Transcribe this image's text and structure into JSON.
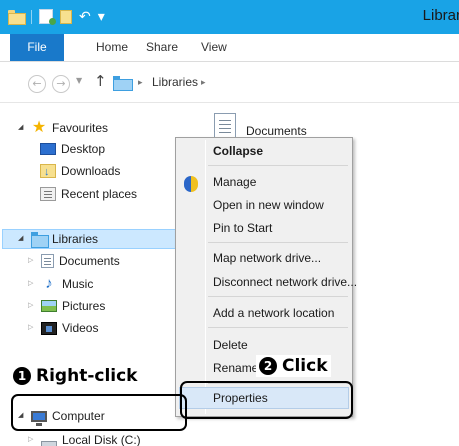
{
  "window": {
    "title": "Librar"
  },
  "ribbon": {
    "tabs": [
      "File",
      "Home",
      "Share",
      "View"
    ]
  },
  "address": {
    "back_glyph": "←",
    "forward_glyph": "→",
    "dropdown_glyph": "▼",
    "up_glyph": "↑",
    "separator_glyph": "▸",
    "crumbs": [
      "Libraries"
    ]
  },
  "nav": {
    "favourites": {
      "label": "Favourites",
      "items": [
        "Desktop",
        "Downloads",
        "Recent places"
      ]
    },
    "libraries": {
      "label": "Libraries",
      "items": [
        "Documents",
        "Music",
        "Pictures",
        "Videos"
      ]
    },
    "computer": {
      "label": "Computer",
      "items": [
        "Local Disk (C:)"
      ]
    }
  },
  "content": {
    "items": [
      "Documents"
    ]
  },
  "context_menu": {
    "items": [
      "Collapse",
      "Manage",
      "Open in new window",
      "Pin to Start",
      "Map network drive...",
      "Disconnect network drive...",
      "Add a network location",
      "Delete",
      "Rename",
      "Properties"
    ]
  },
  "annotations": {
    "step1": {
      "number": "1",
      "text": "Right-click"
    },
    "step2": {
      "number": "2",
      "text": "Click"
    }
  },
  "colors": {
    "titlebar": "#19a3e6",
    "file_tab": "#1979ca",
    "selection": "#cce8ff",
    "menu_bg": "#f0f0f0"
  }
}
